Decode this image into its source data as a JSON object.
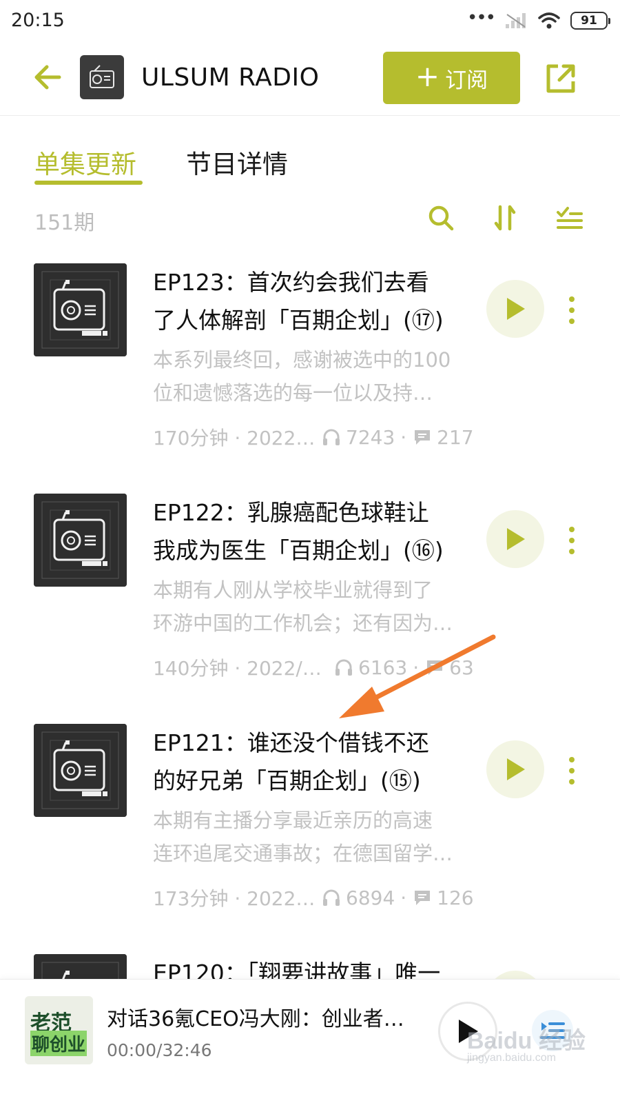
{
  "status_bar": {
    "time": "20:15",
    "battery": "91",
    "icons": [
      "more-dots-icon",
      "signal-icon",
      "wifi-icon",
      "battery-icon"
    ]
  },
  "header": {
    "title": "ULSUM RADIO",
    "subscribe_label": "订阅",
    "icons": [
      "back-arrow-icon",
      "radio-icon",
      "plus-icon",
      "share-icon"
    ]
  },
  "tabs": [
    {
      "label": "单集更新",
      "active": true
    },
    {
      "label": "节目详情",
      "active": false
    }
  ],
  "toolbar": {
    "count": "151期",
    "icons": [
      "search-icon",
      "sort-icon",
      "filter-list-icon"
    ]
  },
  "episodes": [
    {
      "title": "EP123：首次约会我们去看了人体解剖「百期企划」(⑰)",
      "title_lines": [
        "EP123：首次约会我们去看",
        "了人体解剖「百期企划」(⑰)"
      ],
      "desc_lines": [
        "本系列最终回，感谢被选中的100",
        "位和遗憾落选的每一位以及持…"
      ],
      "meta_duration": "170分钟 · 2022…",
      "plays": "7243",
      "comments": "217"
    },
    {
      "title": "EP122：乳腺癌配色球鞋让我成为医生「百期企划」(⑯)",
      "title_lines": [
        "EP122：乳腺癌配色球鞋让",
        "我成为医生「百期企划」(⑯)"
      ],
      "desc_lines": [
        "本期有人刚从学校毕业就得到了",
        "环游中国的工作机会；还有因为…"
      ],
      "meta_duration": "140分钟 · 2022/…",
      "plays": "6163",
      "comments": "63"
    },
    {
      "title": "EP121：谁还没个借钱不还的好兄弟「百期企划」(⑮)",
      "title_lines": [
        "EP121：谁还没个借钱不还",
        "的好兄弟「百期企划」(⑮)"
      ],
      "desc_lines": [
        "本期有主播分享最近亲历的高速",
        "连环追尾交通事故；在德国留学…"
      ],
      "meta_duration": "173分钟 · 2022…",
      "plays": "6894",
      "comments": "126"
    },
    {
      "title": "EP120：「翔要讲故事」唯一",
      "title_lines": [
        "EP120：「翔要讲故事」唯一"
      ],
      "desc_lines": [],
      "meta_duration": "",
      "plays": "",
      "comments": ""
    }
  ],
  "mini_player": {
    "title": "对话36氪CEO冯大刚：创业者…",
    "time": "00:00/32:46",
    "cover_line1": "老范",
    "cover_line2": "聊创业",
    "icons": [
      "play-icon",
      "playlist-icon"
    ]
  },
  "watermark": {
    "main": "Baidu 经验",
    "sub": "jingyan.baidu.com"
  },
  "colors": {
    "accent": "#b5bd2e",
    "text": "#111111",
    "muted": "#c2c2c2",
    "play_bg": "#f3f5e3",
    "annotation_arrow": "#f07a2e"
  }
}
